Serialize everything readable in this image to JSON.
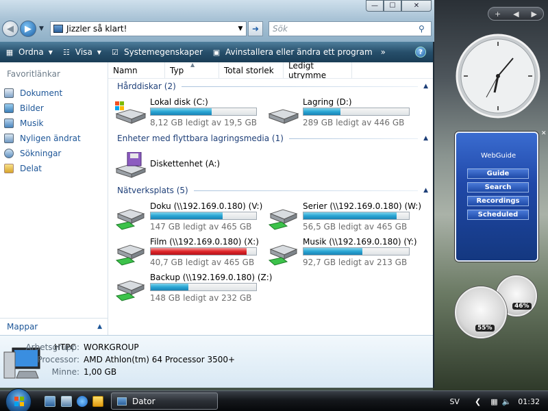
{
  "window": {
    "address": "Jizzler så klart!",
    "search_placeholder": "Sök",
    "controls": {
      "minimize": "—",
      "maximize": "☐",
      "close": "✕"
    }
  },
  "toolbar": {
    "organize": "Ordna",
    "views": "Visa",
    "system_properties": "Systemegenskaper",
    "uninstall": "Avinstallera eller ändra ett program",
    "more": "»",
    "help": "?"
  },
  "sidebar": {
    "header": "Favoritlänkar",
    "items": [
      {
        "label": "Dokument",
        "icon": "documents-icon"
      },
      {
        "label": "Bilder",
        "icon": "pictures-icon"
      },
      {
        "label": "Musik",
        "icon": "music-icon"
      },
      {
        "label": "Nyligen ändrat",
        "icon": "recent-icon"
      },
      {
        "label": "Sökningar",
        "icon": "searches-icon"
      },
      {
        "label": "Delat",
        "icon": "shared-icon"
      }
    ],
    "folders_label": "Mappar"
  },
  "columns": [
    "Namn",
    "Typ",
    "Total storlek",
    "Ledigt utrymme"
  ],
  "groups": {
    "hard_disks": {
      "title": "Hårddiskar (2)",
      "drives": [
        {
          "name": "Lokal disk (C:)",
          "free": "8,12 GB ledigt av 19,5 GB",
          "used_fraction": 0.58
        },
        {
          "name": "Lagring (D:)",
          "free": "289 GB ledigt av 446 GB",
          "used_fraction": 0.35
        }
      ]
    },
    "removable": {
      "title": "Enheter med flyttbara lagringsmedia (1)",
      "drives": [
        {
          "name": "Diskettenhet (A:)"
        }
      ]
    },
    "network": {
      "title": "Nätverksplats (5)",
      "drives": [
        {
          "name": "Doku (\\\\192.169.0.180) (V:)",
          "free": "147 GB ledigt av 465 GB",
          "used_fraction": 0.68
        },
        {
          "name": "Serier (\\\\192.169.0.180) (W:)",
          "free": "56,5 GB ledigt av 465 GB",
          "used_fraction": 0.88
        },
        {
          "name": "Film (\\\\192.169.0.180) (X:)",
          "free": "40,7 GB ledigt av 465 GB",
          "used_fraction": 0.91,
          "warning": true
        },
        {
          "name": "Musik (\\\\192.169.0.180) (Y:)",
          "free": "92,7 GB ledigt av 213 GB",
          "used_fraction": 0.56
        },
        {
          "name": "Backup (\\\\192.169.0.180) (Z:)",
          "free": "148 GB ledigt av 232 GB",
          "used_fraction": 0.36
        }
      ]
    }
  },
  "details": {
    "computer": "HTPC",
    "workgroup_label": "Arbetsgrupp:",
    "workgroup": "WORKGROUP",
    "processor_label": "Processor:",
    "processor": "AMD Athlon(tm) 64 Processor 3500+",
    "memory_label": "Minne:",
    "memory": "1,00 GB"
  },
  "taskbar": {
    "active_window": "Dator",
    "language": "SV",
    "time": "01:32"
  },
  "gadgets": {
    "controls": {
      "add": "+",
      "prev": "◀",
      "next": "▶"
    },
    "webguide": {
      "title": "WebGuide",
      "buttons": [
        "Guide",
        "Search",
        "Recordings",
        "Scheduled"
      ]
    },
    "cpu_percent": "55%",
    "mem_percent": "46%"
  },
  "colors": {
    "bar_normal": "#2aa6d4",
    "bar_warning": "#e0262a",
    "link": "#1c5597",
    "group_title": "#1e3f78"
  }
}
